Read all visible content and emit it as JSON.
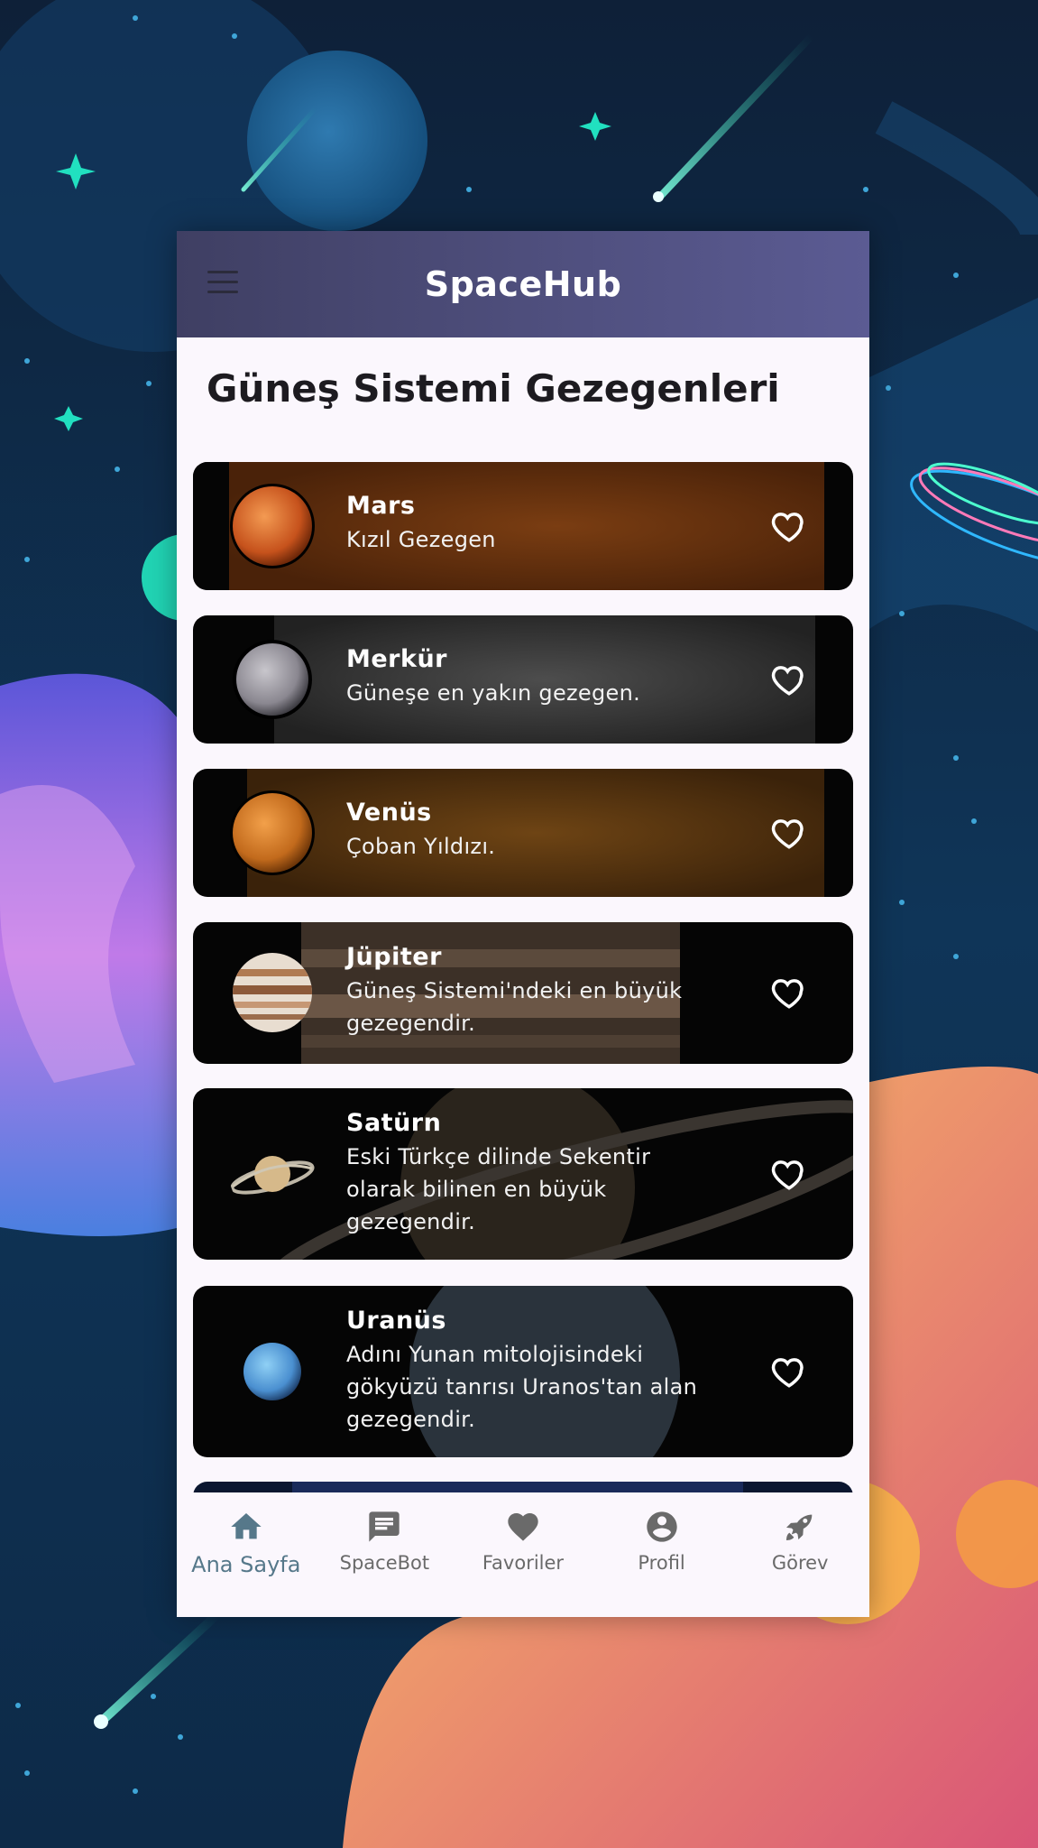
{
  "app": {
    "title": "SpaceHub"
  },
  "page": {
    "title": "Güneş Sistemi Gezegenleri"
  },
  "planets": [
    {
      "name": "Mars",
      "desc": "Kızıl Gezegen",
      "favorited": false
    },
    {
      "name": "Merkür",
      "desc": "Güneşe en yakın gezegen.",
      "favorited": false
    },
    {
      "name": "Venüs",
      "desc": "Çoban Yıldızı.",
      "favorited": false
    },
    {
      "name": "Jüpiter",
      "desc": "Güneş Sistemi'ndeki en büyük gezegendir.",
      "favorited": false
    },
    {
      "name": "Satürn",
      "desc": "Eski Türkçe dilinde Sekentir olarak bilinen en büyük gezegendir.",
      "favorited": false
    },
    {
      "name": "Uranüs",
      "desc": "Adını Yunan mitolojisindeki gökyüzü tanrısı Uranos'tan alan gezegendir.",
      "favorited": false
    }
  ],
  "nav": {
    "items": [
      {
        "label": "Ana Sayfa",
        "icon": "home-icon",
        "active": true
      },
      {
        "label": "SpaceBot",
        "icon": "chat-icon",
        "active": false
      },
      {
        "label": "Favoriler",
        "icon": "heart-icon",
        "active": false
      },
      {
        "label": "Profil",
        "icon": "account-icon",
        "active": false
      },
      {
        "label": "Görev",
        "icon": "rocket-icon",
        "active": false
      }
    ]
  },
  "colors": {
    "appbar": "#4e4e7c",
    "surface": "#fbf7fd",
    "nav_active": "#56788a",
    "nav_inactive": "#6a6a6a"
  }
}
